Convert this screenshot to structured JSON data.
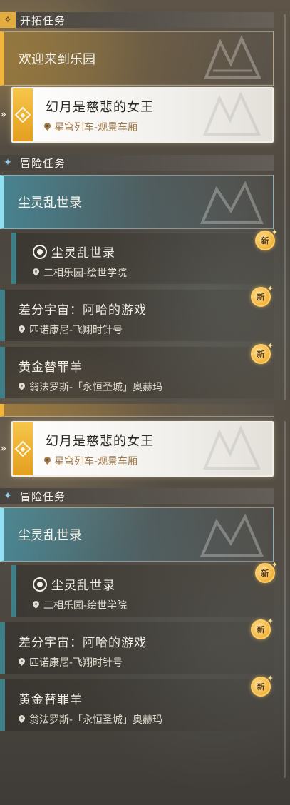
{
  "top": {
    "sections": {
      "trailblaze": {
        "title": "开拓任务"
      },
      "adventure": {
        "title": "冒险任务"
      }
    },
    "trailblaze_card": {
      "title": "欢迎来到乐园"
    },
    "selected_quest": {
      "title": "幻月是慈悲的女王",
      "location": "星穹列车-观景车厢"
    },
    "adventure_card": {
      "title": "尘灵乱世录"
    },
    "quests": [
      {
        "title": "尘灵乱世录",
        "location": "二相乐园-绘世学院",
        "badge": "新"
      },
      {
        "title": "差分宇宙：阿哈的游戏",
        "location": "匹诺康尼-飞翔时针号",
        "badge": "新"
      },
      {
        "title": "黄金替罪羊",
        "location": "翁法罗斯-「永恒圣城」奥赫玛",
        "badge": "新"
      }
    ]
  },
  "bottom": {
    "sections": {
      "adventure": {
        "title": "冒险任务"
      }
    },
    "selected_quest": {
      "title": "幻月是慈悲的女王",
      "location": "星穹列车-观景车厢"
    },
    "adventure_card": {
      "title": "尘灵乱世录"
    },
    "quests": [
      {
        "title": "尘灵乱世录",
        "location": "二相乐园-绘世学院",
        "badge": "新"
      },
      {
        "title": "差分宇宙：阿哈的游戏",
        "location": "匹诺康尼-飞翔时针号",
        "badge": "新"
      },
      {
        "title": "黄金替罪羊",
        "location": "翁法罗斯-「永恒圣城」奥赫玛",
        "badge": "新"
      }
    ]
  },
  "colors": {
    "trailblaze_accent": "#f0b53a",
    "adventure_accent": "#8fe0f2",
    "quest_bar": "#3f7f88",
    "location_text_selected": "#a07a4a",
    "new_badge": "#f1b23a"
  },
  "icons": {
    "trailblaze_section": "diamond-star-icon",
    "adventure_section": "four-point-star-icon",
    "location": "map-pin-icon",
    "dust_quest": "dust-spirit-icon",
    "selected_marker": "double-chevron-icon"
  }
}
